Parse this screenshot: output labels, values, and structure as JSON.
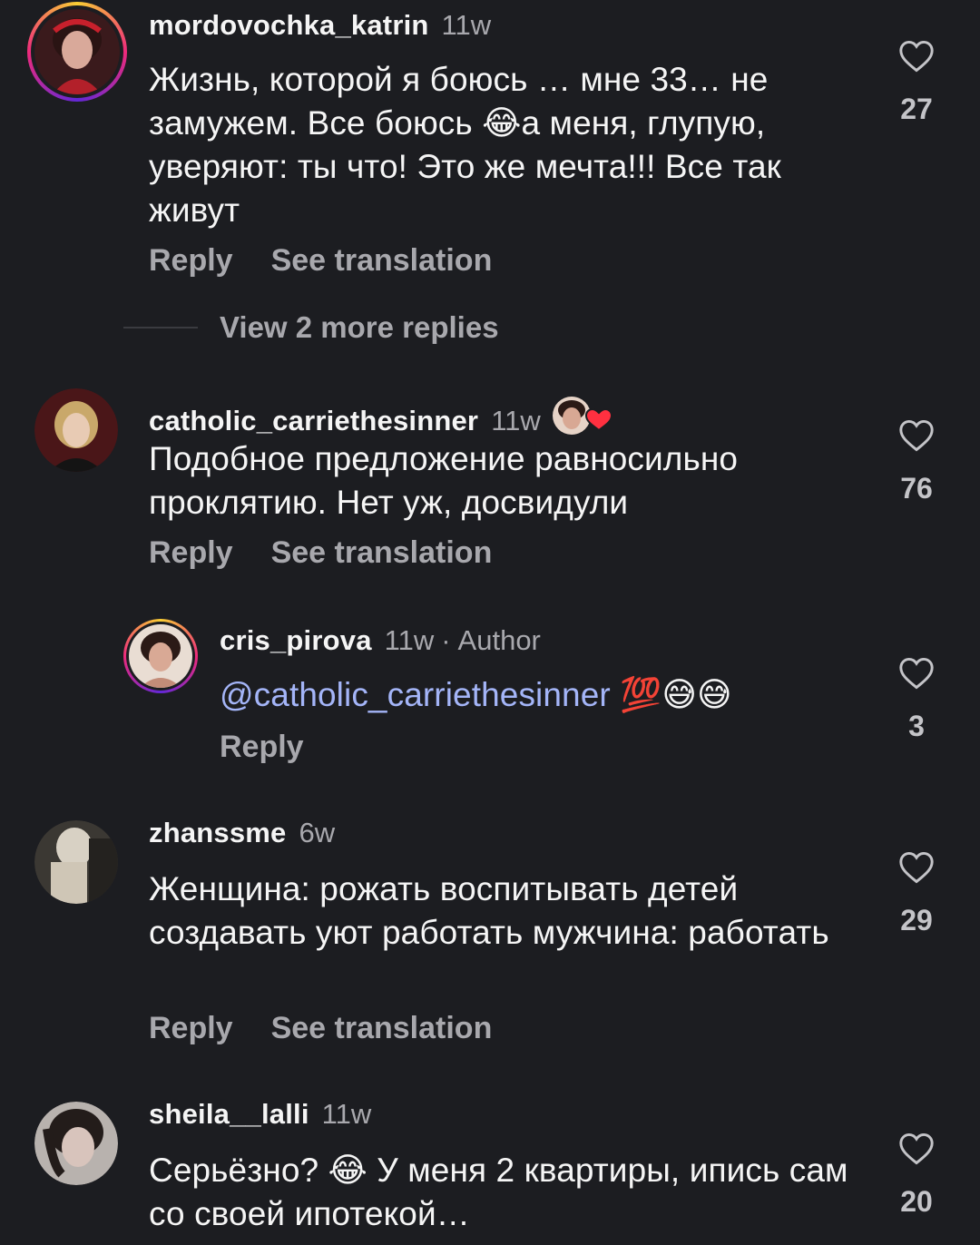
{
  "comments": [
    {
      "username": "mordovochka_katrin",
      "time": "11w",
      "text": "Жизнь, которой я боюсь … мне 33… не замужем. Все боюсь 😂а меня, глупую, уверяют: ты что! Это же мечта!!! Все так живут",
      "reply": "Reply",
      "translate": "See translation",
      "likes": "27"
    },
    {
      "username": "catholic_carriethesinner",
      "time": "11w",
      "text": "Подобное предложение равносильно проклятию. Нет уж, досвидули",
      "reply": "Reply",
      "translate": "See translation",
      "likes": "76"
    },
    {
      "username": "cris_pirova",
      "time": "11w",
      "author_label": "Author",
      "mention": "@catholic_carriethesinner",
      "text_after": " 💯😅😅",
      "reply": "Reply",
      "likes": "3"
    },
    {
      "username": "zhanssme",
      "time": "6w",
      "text": "Женщина: рожать воспитывать детей создавать уют работать мужчина: работать",
      "reply": "Reply",
      "translate": "See translation",
      "likes": "29"
    },
    {
      "username": "sheila__lalli",
      "time": "11w",
      "text": "Серьёзно? 😂 У меня 2 квартиры, ипись сам со своей ипотекой…",
      "likes": "20"
    }
  ],
  "view_more": "View 2 more replies",
  "dot": "·",
  "colors": {
    "background": "#1c1d21",
    "mention": "#a4b5f8",
    "muted": "#a8a8ad",
    "heart_liked": "#ff3040"
  },
  "icons": {
    "like": "heart-outline-icon",
    "creator_liked": "creator-heart-badge-icon"
  }
}
